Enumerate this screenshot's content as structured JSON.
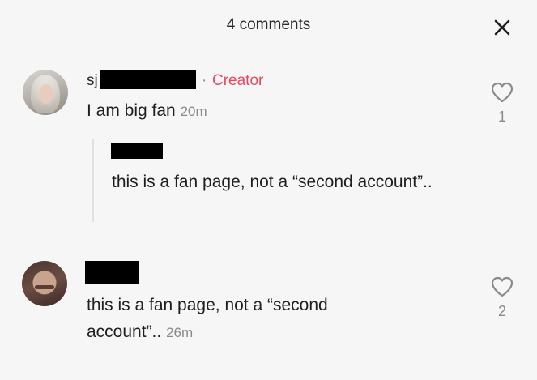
{
  "header": {
    "title": "4 comments",
    "close_icon": "close-icon"
  },
  "comments": [
    {
      "username_visible": "sj",
      "separator": "·",
      "badge": "Creator",
      "text": "I am big fan",
      "time": "20m",
      "likes": "1",
      "reply": {
        "text": "this is a fan page, not a “second account”.."
      }
    },
    {
      "text_line1": "this is a fan page, not a “second",
      "text_line2": "account”..",
      "time": "26m",
      "likes": "2"
    }
  ],
  "colors": {
    "background": "#f7f6f6",
    "creator_badge": "#e8475f",
    "muted": "#8a8a8a",
    "redaction": "#000000"
  }
}
